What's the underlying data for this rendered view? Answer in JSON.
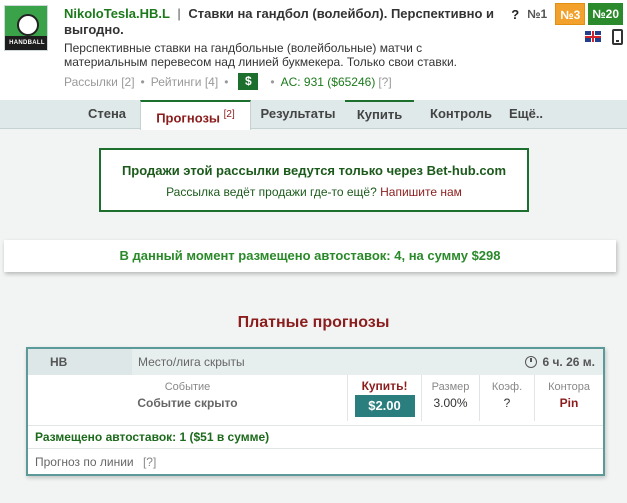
{
  "header": {
    "nick": "NikoloTesla.HB.L",
    "separator": "|",
    "title": "Ставки на гандбол (волейбол). Перспективно и выгодно.",
    "description": "Перспективные ставки на гандбольные (волейбольные) матчи с материальным перевесом над линией букмекера. Только свои ставки.",
    "mailings": "Рассылки [2]",
    "ratings": "Рейтинги [4]",
    "dollar": "$",
    "ac": "AC: 931 ($65246)",
    "ac_help": "[?]",
    "help": "?",
    "rank1": "№1",
    "rank3": "№3",
    "rank20": "№20",
    "logo_text": "HANDBALL"
  },
  "tabs": {
    "wall": "Стена",
    "forecasts": "Прогнозы",
    "forecasts_count": "[2]",
    "results": "Результаты",
    "buy": "Купить",
    "control": "Контроль",
    "more": "Ещё.."
  },
  "notice": {
    "line1": "Продажи этой рассылки ведутся только через Bet-hub.com",
    "line2": "Рассылка ведёт продажи где-то ещё?",
    "link": "Напишите нам"
  },
  "autobets": "В данный момент размещено автоставок: 4, на сумму $298",
  "paid": {
    "title": "Платные прогнозы",
    "card": {
      "hb": "HB",
      "place": "Место/лига скрыты",
      "time": "6 ч. 26 м.",
      "event_label": "Событие",
      "event_value": "Событие скрыто",
      "buy_label": "Купить!",
      "price": "$2.00",
      "size_label": "Размер",
      "size_value": "3.00%",
      "coef_label": "Коэф.",
      "coef_value": "?",
      "bk_label": "Контора",
      "bk_value": "Pin",
      "autobets": "Размещено автоставок: 1 ($51 в сумме)",
      "line_forecast": "Прогноз по линии",
      "line_help": "[?]"
    }
  },
  "colors": {
    "accent_green": "#1d6f2d",
    "accent_red": "#8b1d1d",
    "teal": "#2a7e7e",
    "orange": "#f2a22c"
  }
}
